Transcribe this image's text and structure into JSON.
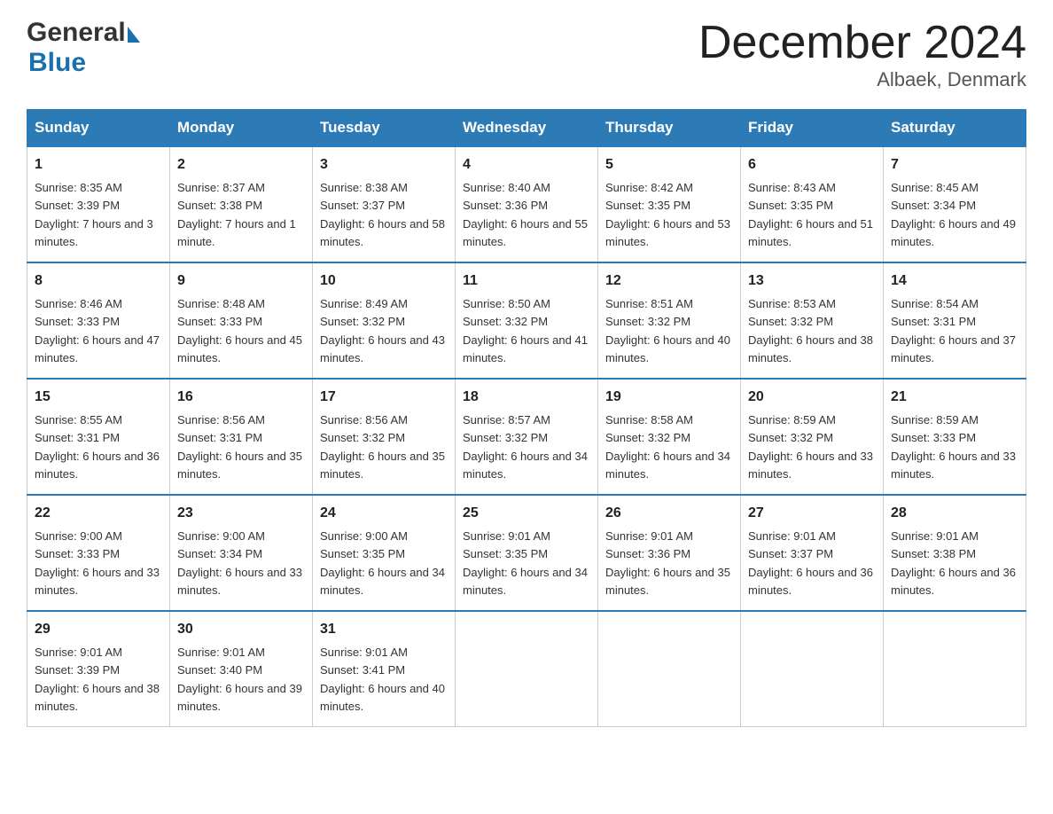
{
  "header": {
    "title": "December 2024",
    "subtitle": "Albaek, Denmark",
    "logo_general": "General",
    "logo_blue": "Blue"
  },
  "columns": [
    "Sunday",
    "Monday",
    "Tuesday",
    "Wednesday",
    "Thursday",
    "Friday",
    "Saturday"
  ],
  "weeks": [
    [
      {
        "day": "1",
        "sunrise": "8:35 AM",
        "sunset": "3:39 PM",
        "daylight": "7 hours and 3 minutes."
      },
      {
        "day": "2",
        "sunrise": "8:37 AM",
        "sunset": "3:38 PM",
        "daylight": "7 hours and 1 minute."
      },
      {
        "day": "3",
        "sunrise": "8:38 AM",
        "sunset": "3:37 PM",
        "daylight": "6 hours and 58 minutes."
      },
      {
        "day": "4",
        "sunrise": "8:40 AM",
        "sunset": "3:36 PM",
        "daylight": "6 hours and 55 minutes."
      },
      {
        "day": "5",
        "sunrise": "8:42 AM",
        "sunset": "3:35 PM",
        "daylight": "6 hours and 53 minutes."
      },
      {
        "day": "6",
        "sunrise": "8:43 AM",
        "sunset": "3:35 PM",
        "daylight": "6 hours and 51 minutes."
      },
      {
        "day": "7",
        "sunrise": "8:45 AM",
        "sunset": "3:34 PM",
        "daylight": "6 hours and 49 minutes."
      }
    ],
    [
      {
        "day": "8",
        "sunrise": "8:46 AM",
        "sunset": "3:33 PM",
        "daylight": "6 hours and 47 minutes."
      },
      {
        "day": "9",
        "sunrise": "8:48 AM",
        "sunset": "3:33 PM",
        "daylight": "6 hours and 45 minutes."
      },
      {
        "day": "10",
        "sunrise": "8:49 AM",
        "sunset": "3:32 PM",
        "daylight": "6 hours and 43 minutes."
      },
      {
        "day": "11",
        "sunrise": "8:50 AM",
        "sunset": "3:32 PM",
        "daylight": "6 hours and 41 minutes."
      },
      {
        "day": "12",
        "sunrise": "8:51 AM",
        "sunset": "3:32 PM",
        "daylight": "6 hours and 40 minutes."
      },
      {
        "day": "13",
        "sunrise": "8:53 AM",
        "sunset": "3:32 PM",
        "daylight": "6 hours and 38 minutes."
      },
      {
        "day": "14",
        "sunrise": "8:54 AM",
        "sunset": "3:31 PM",
        "daylight": "6 hours and 37 minutes."
      }
    ],
    [
      {
        "day": "15",
        "sunrise": "8:55 AM",
        "sunset": "3:31 PM",
        "daylight": "6 hours and 36 minutes."
      },
      {
        "day": "16",
        "sunrise": "8:56 AM",
        "sunset": "3:31 PM",
        "daylight": "6 hours and 35 minutes."
      },
      {
        "day": "17",
        "sunrise": "8:56 AM",
        "sunset": "3:32 PM",
        "daylight": "6 hours and 35 minutes."
      },
      {
        "day": "18",
        "sunrise": "8:57 AM",
        "sunset": "3:32 PM",
        "daylight": "6 hours and 34 minutes."
      },
      {
        "day": "19",
        "sunrise": "8:58 AM",
        "sunset": "3:32 PM",
        "daylight": "6 hours and 34 minutes."
      },
      {
        "day": "20",
        "sunrise": "8:59 AM",
        "sunset": "3:32 PM",
        "daylight": "6 hours and 33 minutes."
      },
      {
        "day": "21",
        "sunrise": "8:59 AM",
        "sunset": "3:33 PM",
        "daylight": "6 hours and 33 minutes."
      }
    ],
    [
      {
        "day": "22",
        "sunrise": "9:00 AM",
        "sunset": "3:33 PM",
        "daylight": "6 hours and 33 minutes."
      },
      {
        "day": "23",
        "sunrise": "9:00 AM",
        "sunset": "3:34 PM",
        "daylight": "6 hours and 33 minutes."
      },
      {
        "day": "24",
        "sunrise": "9:00 AM",
        "sunset": "3:35 PM",
        "daylight": "6 hours and 34 minutes."
      },
      {
        "day": "25",
        "sunrise": "9:01 AM",
        "sunset": "3:35 PM",
        "daylight": "6 hours and 34 minutes."
      },
      {
        "day": "26",
        "sunrise": "9:01 AM",
        "sunset": "3:36 PM",
        "daylight": "6 hours and 35 minutes."
      },
      {
        "day": "27",
        "sunrise": "9:01 AM",
        "sunset": "3:37 PM",
        "daylight": "6 hours and 36 minutes."
      },
      {
        "day": "28",
        "sunrise": "9:01 AM",
        "sunset": "3:38 PM",
        "daylight": "6 hours and 36 minutes."
      }
    ],
    [
      {
        "day": "29",
        "sunrise": "9:01 AM",
        "sunset": "3:39 PM",
        "daylight": "6 hours and 38 minutes."
      },
      {
        "day": "30",
        "sunrise": "9:01 AM",
        "sunset": "3:40 PM",
        "daylight": "6 hours and 39 minutes."
      },
      {
        "day": "31",
        "sunrise": "9:01 AM",
        "sunset": "3:41 PM",
        "daylight": "6 hours and 40 minutes."
      },
      null,
      null,
      null,
      null
    ]
  ]
}
